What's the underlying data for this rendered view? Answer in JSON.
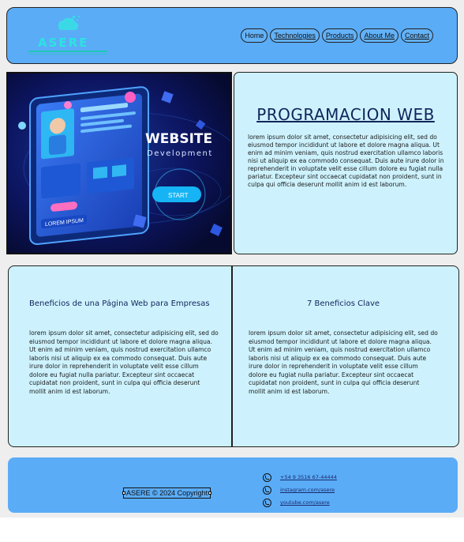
{
  "brand": {
    "logo_text": "ASERE"
  },
  "nav": {
    "items": [
      {
        "label": "Home"
      },
      {
        "label": "Technologies"
      },
      {
        "label": "Products"
      },
      {
        "label": "About Me"
      },
      {
        "label": "Contact"
      }
    ]
  },
  "hero": {
    "image": {
      "title": "WEBSITE",
      "subtitle": "Development",
      "button": "START",
      "screen_label": "LOREM IPSUM"
    },
    "title": "PROGRAMACION WEB",
    "text": "lorem ipsum dolor sit amet, consectetur adipisicing elit, sed do eiusmod tempor incididunt ut labore et dolore magna aliqua. Ut enim ad minim veniam, quis nostrud exercitation ullamco laboris nisi ut aliquip ex ea commodo consequat. Duis aute irure dolor in reprehenderit in voluptate velit esse cillum dolore eu fugiat nulla pariatur. Excepteur sint occaecat cupidatat non proident, sunt in culpa qui officia deserunt mollit anim id est laborum."
  },
  "benefits": {
    "left": {
      "title": "Beneficios de una Página Web para Empresas",
      "text": "lorem ipsum dolor sit amet, consectetur adipisicing elit, sed do eiusmod tempor incididunt ut labore et dolore magna aliqua. Ut enim ad minim veniam, quis nostrud exercitation ullamco laboris nisi ut aliquip ex ea commodo consequat. Duis aute irure dolor in reprehenderit in voluptate velit esse cillum dolore eu fugiat nulla pariatur. Excepteur sint occaecat cupidatat non proident, sunt in culpa qui officia deserunt mollit anim id est laborum."
    },
    "right": {
      "title": "7 Beneficios Clave",
      "text": "lorem ipsum dolor sit amet, consectetur adipisicing elit, sed do eiusmod tempor incididunt ut labore et dolore magna aliqua. Ut enim ad minim veniam, quis nostrud exercitation ullamco laboris nisi ut aliquip ex ea commodo consequat. Duis aute irure dolor in reprehenderit in voluptate velit esse cillum dolore eu fugiat nulla pariatur. Excepteur sint occaecat cupidatat non proident, sunt in culpa qui officia deserunt mollit anim id est laborum."
    }
  },
  "footer": {
    "copyright": "ASERE © 2024 Copyright",
    "contacts": [
      {
        "icon": "whatsapp-icon",
        "label": "+54 9 3516 67-44444"
      },
      {
        "icon": "whatsapp-icon",
        "label": "instagram.com/asere"
      },
      {
        "icon": "whatsapp-icon",
        "label": "youtube.com/asere"
      }
    ]
  },
  "colors": {
    "header_bg": "#5aacf7",
    "panel_bg": "#cdf2fd",
    "title_color": "#12245a",
    "logo_color": "#2be3df",
    "page_bg": "#eeeeee"
  }
}
